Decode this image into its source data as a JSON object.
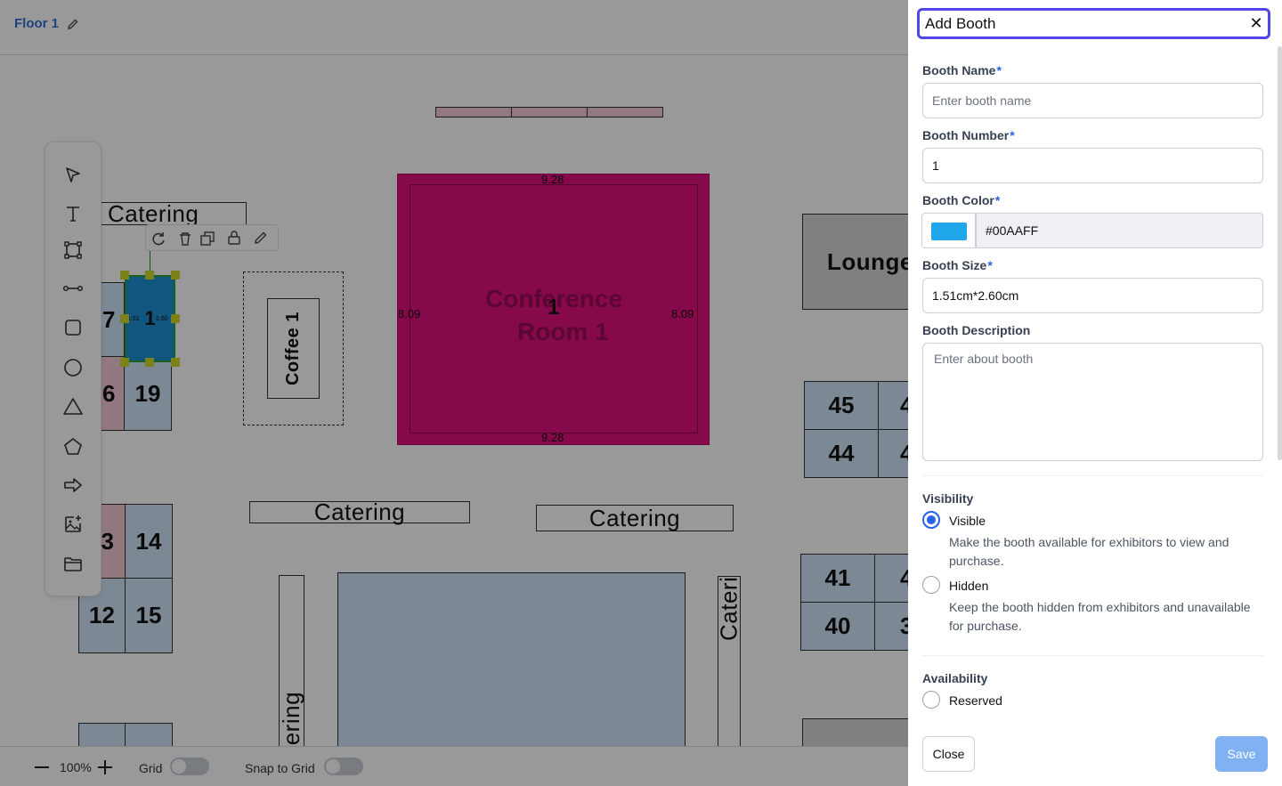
{
  "editor": {
    "floor_title": "Floor 1",
    "edit_icon": "pencil-icon",
    "tools": [
      "select-icon",
      "text-icon",
      "polygon-select-icon",
      "line-icon",
      "rectangle-icon",
      "circle-icon",
      "triangle-icon",
      "pentagon-icon",
      "arrow-icon",
      "image-add-icon",
      "folder-icon"
    ],
    "selection_toolbar": [
      "rotate-icon",
      "delete-icon",
      "duplicate-icon",
      "lock-icon",
      "edit-icon"
    ],
    "canvas": {
      "catering_labels": [
        "Catering",
        "Catering",
        "Catering"
      ],
      "catering_vertical": [
        "tering",
        "Cateri"
      ],
      "coffee_label": "Coffee 1",
      "lounge_label": "Lounge",
      "conference_label_1": "Conference",
      "conference_label_2": "Room 1",
      "conference_number": "1",
      "conference_dims": {
        "top": "9.28",
        "bottom": "9.28",
        "left": "8.09",
        "right": "8.09"
      },
      "selected_booth": {
        "number": "1",
        "small_left": "1.51",
        "small_right": "2.60"
      },
      "booths": {
        "b7": "7",
        "b6": "6",
        "b19": "19",
        "b3": "3",
        "b14": "14",
        "b12": "12",
        "b15": "15",
        "b45": "45",
        "b44": "44",
        "b41": "41",
        "b40": "40",
        "b4a": "4",
        "b4b": "4",
        "b4c": "4",
        "b3b": "3"
      }
    },
    "bottom": {
      "zoom_out_icon": "minus-icon",
      "zoom": "100%",
      "zoom_in_icon": "plus-icon",
      "grid_label": "Grid",
      "snap_label": "Snap to Grid"
    }
  },
  "drawer": {
    "title": "Add Booth",
    "close_icon": "close-icon",
    "fields": {
      "name_label": "Booth Name",
      "name_placeholder": "Enter booth name",
      "number_label": "Booth Number",
      "number_value": "1",
      "color_label": "Booth Color",
      "color_value": "#00AAFF",
      "size_label": "Booth Size",
      "size_value": "1.51cm*2.60cm",
      "description_label": "Booth Description",
      "description_placeholder": "Enter about booth",
      "required_mark": "*"
    },
    "visibility": {
      "heading": "Visibility",
      "visible_label": "Visible",
      "visible_desc": "Make the booth available for exhibitors to view and purchase.",
      "hidden_label": "Hidden",
      "hidden_desc": "Keep the booth hidden from exhibitors and unavailable for purchase.",
      "selected": "Visible"
    },
    "availability": {
      "heading": "Availability",
      "reserved_label": "Reserved"
    },
    "footer": {
      "close_label": "Close",
      "save_label": "Save"
    }
  },
  "colors": {
    "accent": "#2563eb",
    "booth_color": "#00AAFF",
    "conference_room": "#e0107e",
    "booth_fill": "#cfe3f6"
  }
}
